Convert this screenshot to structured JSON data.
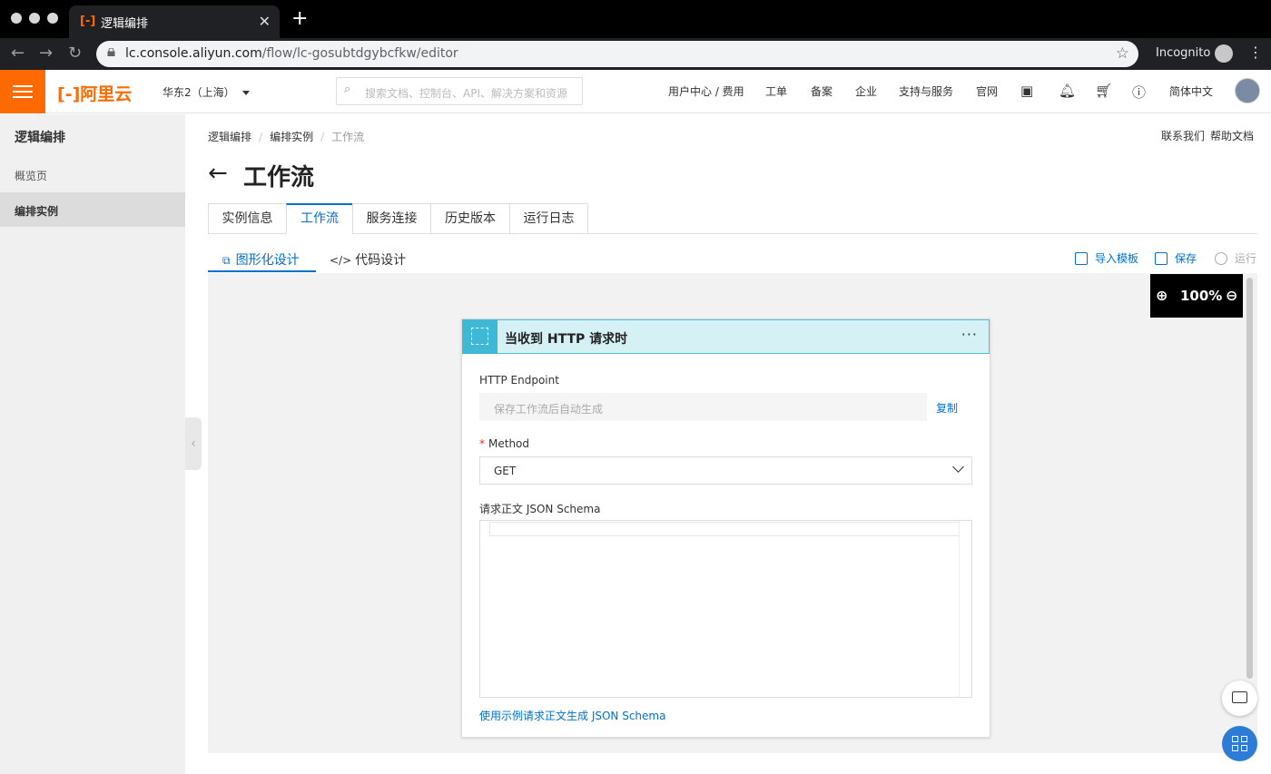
{
  "browser": {
    "tab_title": "逻辑编排",
    "tab_favicon": "[-]",
    "url_host": "lc.console.aliyun.com",
    "url_path": "/flow/lc-gosubtdgybcfkw/editor",
    "incognito_label": "Incognito"
  },
  "header": {
    "logo_text": "[-]阿里云",
    "region": "华东2（上海）",
    "search_placeholder": "搜索文档、控制台、API、解决方案和资源",
    "nav": [
      "用户中心 / 费用",
      "工单",
      "备案",
      "企业",
      "支持与服务",
      "官网"
    ],
    "language": "简体中文",
    "brand_color": "#ff6a00"
  },
  "sidebar": {
    "title": "逻辑编排",
    "items": [
      {
        "label": "概览页",
        "active": false
      },
      {
        "label": "编排实例",
        "active": true
      }
    ]
  },
  "breadcrumb": [
    "逻辑编排",
    "编排实例",
    "工作流"
  ],
  "top_links": [
    "联系我们",
    "帮助文档"
  ],
  "page": {
    "back_icon": "arrow-left-icon",
    "title": "工作流"
  },
  "tabs": [
    {
      "label": "实例信息",
      "active": false
    },
    {
      "label": "工作流",
      "active": true
    },
    {
      "label": "服务连接",
      "active": false
    },
    {
      "label": "历史版本",
      "active": false
    },
    {
      "label": "运行日志",
      "active": false
    }
  ],
  "subtabs": [
    {
      "label": "图形化设计",
      "icon": "flowchart-icon",
      "active": true
    },
    {
      "label": "代码设计",
      "icon": "code-icon",
      "active": false
    }
  ],
  "actions": [
    {
      "label": "导入模板",
      "icon": "import-icon",
      "enabled": true
    },
    {
      "label": "保存",
      "icon": "save-icon",
      "enabled": true
    },
    {
      "label": "运行",
      "icon": "play-icon",
      "enabled": false
    }
  ],
  "zoom": "100%",
  "node": {
    "title": "当收到 HTTP 请求时",
    "more_label": "···",
    "endpoint_label": "HTTP Endpoint",
    "endpoint_placeholder": "保存工作流后自动生成",
    "copy_label": "复制",
    "method_label": "Method",
    "method_required_mark": "*",
    "method_value": "GET",
    "schema_label": "请求正文 JSON Schema",
    "schema_value": "",
    "generate_link": "使用示例请求正文生成 JSON Schema",
    "accent_color": "#3fb8d5"
  },
  "accent_color": "#0070cc"
}
